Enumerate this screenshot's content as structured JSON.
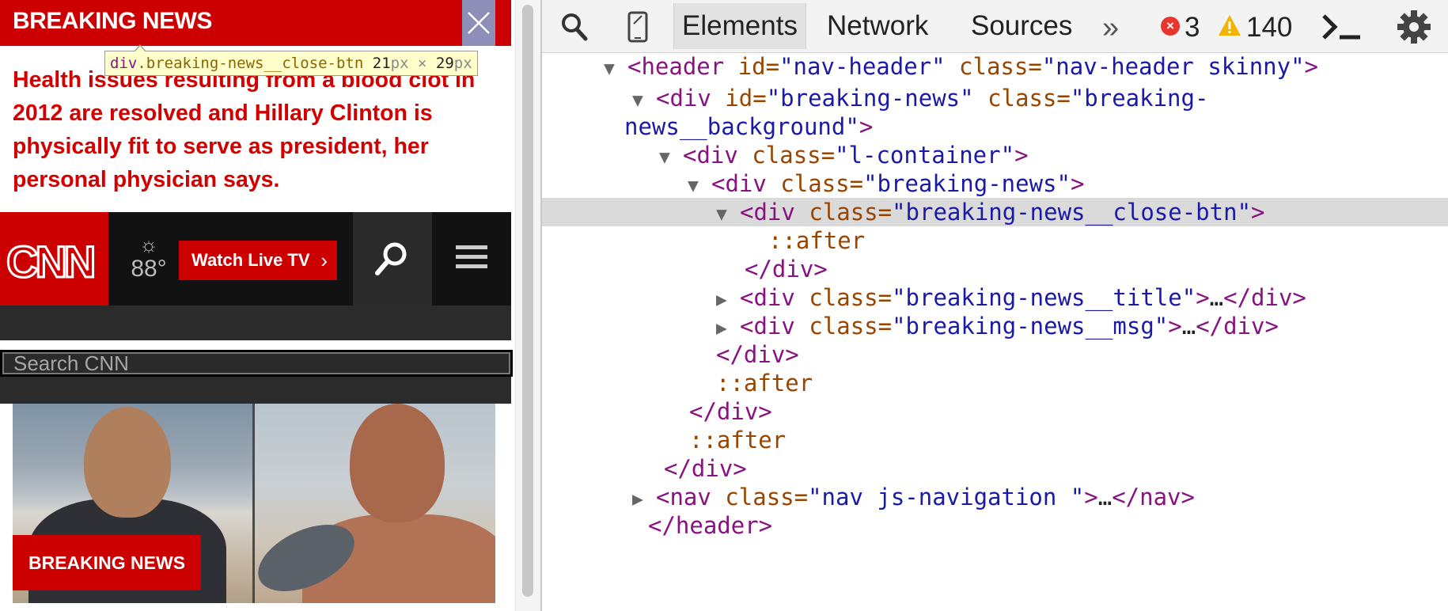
{
  "page": {
    "breaking_title": "BREAKING NEWS",
    "tooltip": {
      "tag": "div",
      "cls": ".breaking-news__close-btn",
      "w": "21",
      "px1": "px",
      "x": " × ",
      "h": "29",
      "px2": "px"
    },
    "breaking_msg": "Health issues resulting from a blood clot in 2012 are resolved and Hillary Clinton is physically fit to serve as president, her personal physician says.",
    "logo": "CNN",
    "weather_icon": "☼",
    "weather_temp": "88°",
    "watch_live": "Watch Live TV",
    "watch_chev": "›",
    "search_placeholder": "Search CNN",
    "photo_badge": "BREAKING NEWS"
  },
  "devtools": {
    "tabs": {
      "elements": "Elements",
      "network": "Network",
      "sources": "Sources",
      "more": "»"
    },
    "errors": "3",
    "warnings": "140",
    "dom": [
      {
        "tri": "▼",
        "parts": [
          [
            "t",
            "<header "
          ],
          [
            "an",
            "id="
          ],
          [
            "av",
            "\"nav-header\""
          ],
          [
            "an",
            " class="
          ],
          [
            "av",
            "\"nav-header skinny\""
          ],
          [
            "t",
            ">"
          ]
        ]
      },
      {
        "tri": "▼",
        "parts": [
          [
            "t",
            "<div "
          ],
          [
            "an",
            "id="
          ],
          [
            "av",
            "\"breaking-news\""
          ],
          [
            "an",
            "  class="
          ],
          [
            "av",
            "\"breaking-"
          ]
        ]
      },
      {
        "tri": "",
        "parts": [
          [
            "av",
            "news__background\""
          ],
          [
            "t",
            ">"
          ]
        ]
      },
      {
        "tri": "▼",
        "parts": [
          [
            "t",
            "<div "
          ],
          [
            "an",
            "class="
          ],
          [
            "av",
            "\"l-container\""
          ],
          [
            "t",
            ">"
          ]
        ]
      },
      {
        "tri": "▼",
        "parts": [
          [
            "t",
            "<div "
          ],
          [
            "an",
            "class="
          ],
          [
            "av",
            "\"breaking-news\""
          ],
          [
            "t",
            ">"
          ]
        ]
      },
      {
        "tri": "▼",
        "parts": [
          [
            "t",
            "<div "
          ],
          [
            "an",
            "class="
          ],
          [
            "av",
            "\"breaking-news__close-btn\""
          ],
          [
            "t",
            ">"
          ]
        ]
      },
      {
        "tri": "",
        "parts": [
          [
            "pe",
            "::after"
          ]
        ]
      },
      {
        "tri": "",
        "parts": [
          [
            "t",
            "</div>"
          ]
        ]
      },
      {
        "tri": "▶",
        "parts": [
          [
            "t",
            "<div "
          ],
          [
            "an",
            "class="
          ],
          [
            "av",
            "\"breaking-news__title\""
          ],
          [
            "t",
            ">"
          ],
          [
            "tx",
            "…"
          ],
          [
            "t",
            "</div>"
          ]
        ]
      },
      {
        "tri": "▶",
        "parts": [
          [
            "t",
            "<div "
          ],
          [
            "an",
            "class="
          ],
          [
            "av",
            "\"breaking-news__msg\""
          ],
          [
            "t",
            ">"
          ],
          [
            "tx",
            "…"
          ],
          [
            "t",
            "</div>"
          ]
        ]
      },
      {
        "tri": "",
        "parts": [
          [
            "t",
            "</div>"
          ]
        ]
      },
      {
        "tri": "",
        "parts": [
          [
            "pe",
            "::after"
          ]
        ]
      },
      {
        "tri": "",
        "parts": [
          [
            "t",
            "</div>"
          ]
        ]
      },
      {
        "tri": "",
        "parts": [
          [
            "pe",
            "::after"
          ]
        ]
      },
      {
        "tri": "",
        "parts": [
          [
            "t",
            "</div>"
          ]
        ]
      },
      {
        "tri": "▶",
        "parts": [
          [
            "t",
            "<nav "
          ],
          [
            "an",
            "class="
          ],
          [
            "av",
            "\"nav js-navigation \""
          ],
          [
            "t",
            ">"
          ],
          [
            "tx",
            "…"
          ],
          [
            "t",
            "</nav>"
          ]
        ]
      },
      {
        "tri": "",
        "parts": [
          [
            "t",
            "</header>"
          ]
        ]
      }
    ]
  }
}
